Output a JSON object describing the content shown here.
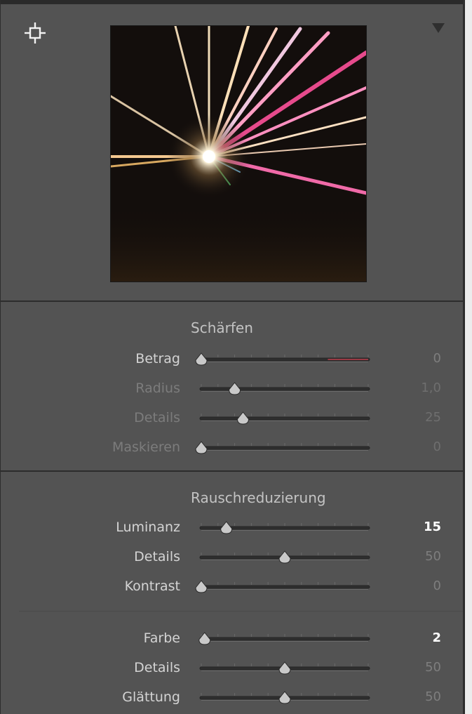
{
  "header": {
    "target_icon": "crosshair-icon",
    "collapse_icon": "triangle-down-icon"
  },
  "sharpening": {
    "title": "Schärfen",
    "sliders": [
      {
        "label": "Betrag",
        "value": "0",
        "fraction": 0.0,
        "dim": false,
        "strong": false,
        "accent": true
      },
      {
        "label": "Radius",
        "value": "1,0",
        "fraction": 0.2,
        "dim": true,
        "strong": false
      },
      {
        "label": "Details",
        "value": "25",
        "fraction": 0.25,
        "dim": true,
        "strong": false
      },
      {
        "label": "Maskieren",
        "value": "0",
        "fraction": 0.0,
        "dim": true,
        "strong": false
      }
    ]
  },
  "noise_reduction": {
    "title": "Rauschreduzierung",
    "sliders": [
      {
        "label": "Luminanz",
        "value": "15",
        "fraction": 0.15,
        "dim": false,
        "strong": true
      },
      {
        "label": "Details",
        "value": "50",
        "fraction": 0.5,
        "dim": false,
        "strong": false
      },
      {
        "label": "Kontrast",
        "value": "0",
        "fraction": 0.0,
        "dim": false,
        "strong": false
      }
    ],
    "color_sliders": [
      {
        "label": "Farbe",
        "value": "2",
        "fraction": 0.02,
        "dim": false,
        "strong": true
      },
      {
        "label": "Details",
        "value": "50",
        "fraction": 0.5,
        "dim": false,
        "strong": false
      },
      {
        "label": "Glättung",
        "value": "50",
        "fraction": 0.5,
        "dim": false,
        "strong": false
      }
    ]
  },
  "colors": {
    "panel": "#535353",
    "accent": "#9a3a44"
  }
}
